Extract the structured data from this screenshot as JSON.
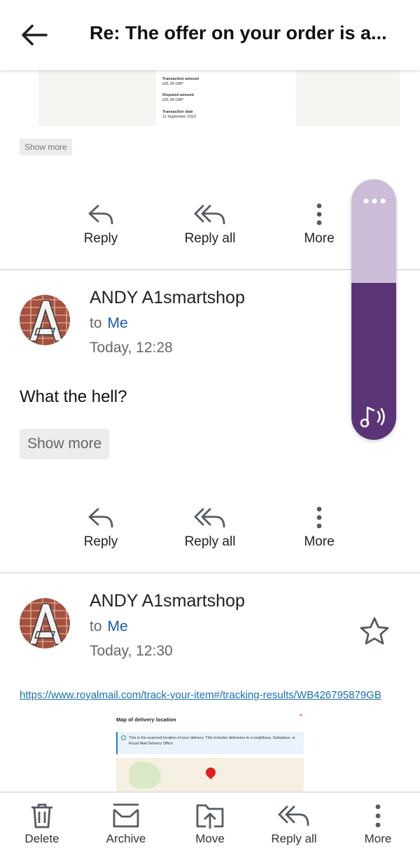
{
  "header": {
    "subject": "Re: The offer on your order is a..."
  },
  "previous": {
    "transaction_amount_label": "Transaction amount",
    "transaction_amount": "£81.99 GBP",
    "disputed_amount_label": "Disputed amount",
    "disputed_amount": "£81.99 GBP",
    "transaction_date_label": "Transaction date",
    "transaction_date": "11 September 2023",
    "show_more": "Show more"
  },
  "actions": {
    "reply": "Reply",
    "reply_all": "Reply all",
    "more": "More"
  },
  "messages": [
    {
      "sender": "ANDY A1smartshop",
      "to_label": "to",
      "recipient": "Me",
      "date": "Today, 12:28",
      "body": "What the hell?",
      "show_more": "Show more"
    },
    {
      "sender": "ANDY A1smartshop",
      "to_label": "to",
      "recipient": "Me",
      "date": "Today, 12:30",
      "link": "https://www.royalmail.com/track-your-item#/tracking-results/WB426795879GB",
      "map_title": "Map of delivery location",
      "map_info": "This is the scanned location of your delivery. This includes deliveries to a neighbour, Safeplace, or Royal Mail Delivery Office."
    }
  ],
  "toolbar": {
    "delete": "Delete",
    "archive": "Archive",
    "move": "Move",
    "reply_all": "Reply all",
    "more": "More"
  },
  "colors": {
    "accent": "#1a56b8",
    "widget_top": "#cbbcd8",
    "widget_bottom": "#5b3478"
  }
}
